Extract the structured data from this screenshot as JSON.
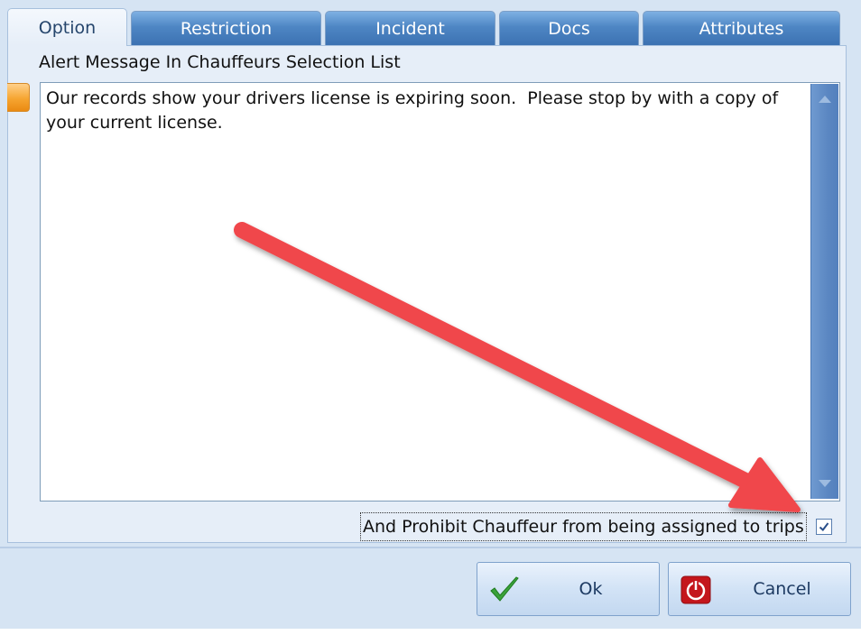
{
  "tabs": [
    {
      "label": "Option",
      "active": true
    },
    {
      "label": "Restriction",
      "active": false
    },
    {
      "label": "Incident",
      "active": false
    },
    {
      "label": "Docs",
      "active": false
    },
    {
      "label": "Attributes",
      "active": false
    }
  ],
  "alert": {
    "label": "Alert Message In Chauffeurs Selection List",
    "message": "Our records show your drivers license is expiring soon.  Please stop by with a copy of\nyour current license."
  },
  "prohibit": {
    "label": "And Prohibit Chauffeur from being assigned to trips",
    "checked": true
  },
  "buttons": {
    "ok_label": "Ok",
    "cancel_label": "Cancel"
  },
  "icons": {
    "ok": "checkmark-icon",
    "cancel": "power-stop-icon",
    "scroll_up": "arrow-up-icon",
    "scroll_down": "arrow-down-icon"
  },
  "colors": {
    "tab_inactive": "#4e86c4",
    "panel": "#e6eef8",
    "annotation_arrow": "#f0474b",
    "accent_orange": "#f6a531",
    "cancel_icon": "#c4161c",
    "ok_icon": "#3aa23a"
  }
}
